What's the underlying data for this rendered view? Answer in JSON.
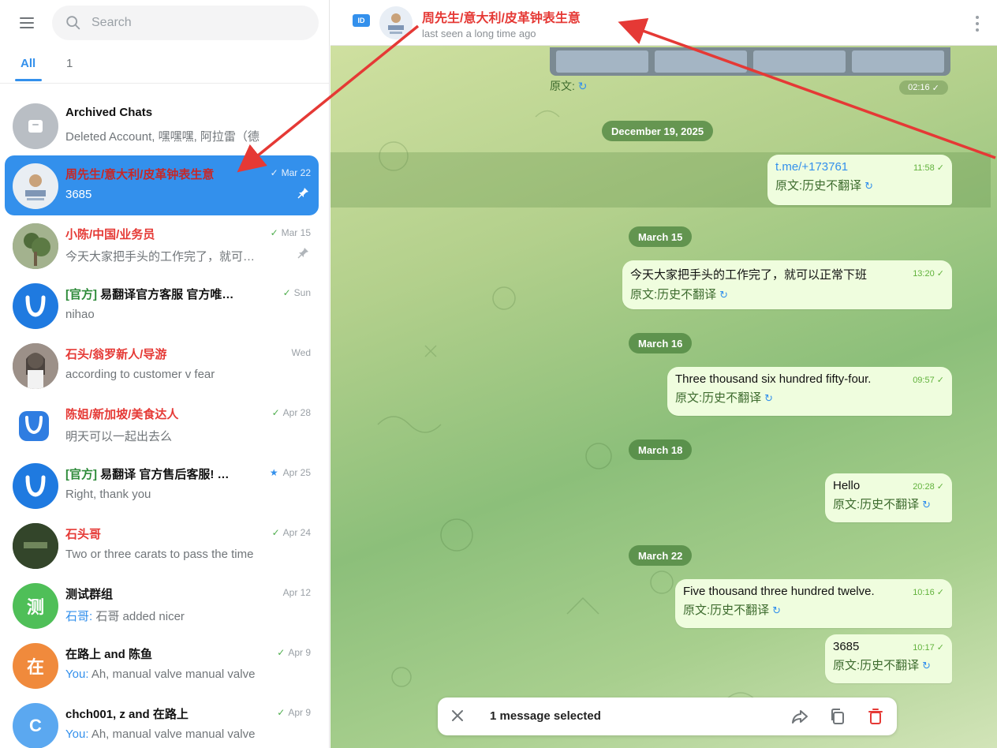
{
  "sidebar": {
    "search_placeholder": "Search",
    "tabs": [
      {
        "label": "All"
      },
      {
        "label": "1"
      }
    ],
    "chats": [
      {
        "name": "Archived Chats",
        "preview": "Deleted Account, 嘿嘿嘿, 阿拉雷（德",
        "time": ""
      },
      {
        "name": "周先生/意大利/皮革钟表生意",
        "preview": "3685",
        "time": "Mar 22"
      },
      {
        "name": "小陈/中国/业务员",
        "preview": "今天大家把手头的工作完了，就可…",
        "time": "Mar 15"
      },
      {
        "name_prefix": "[官方]",
        "name": "易翻译官方客服 官方唯…",
        "preview": "nihao",
        "time": "Sun"
      },
      {
        "name": "石头/翁罗新人/导游",
        "preview": "according to customer v fear",
        "time": "Wed"
      },
      {
        "name": "陈姐/新加坡/美食达人",
        "preview": "明天可以一起出去么",
        "time": "Apr 28"
      },
      {
        "name_prefix": "[官方]",
        "name": "易翻译 官方售后客服! …",
        "preview": "Right, thank you",
        "time": "Apr 25"
      },
      {
        "name": "石头哥",
        "preview": "Two or three carats to pass the time",
        "time": "Apr 24"
      },
      {
        "name": "测试群组",
        "preview": "石哥 added nicer",
        "sender": "石哥:",
        "time": "Apr 12"
      },
      {
        "name": "在路上 and 陈鱼",
        "sender": "You:",
        "preview": "Ah, manual valve manual valve",
        "time": "Apr 9"
      },
      {
        "name": "chch001, z and 在路上",
        "sender": "You:",
        "preview": "Ah, manual valve manual valve",
        "time": "Apr 9"
      }
    ],
    "avatar_letters": {
      "test_group": "测",
      "on_road": "在",
      "chch": "C"
    }
  },
  "header": {
    "badge": "ID",
    "title": "周先生/意大利/皮革钟表生意",
    "subtitle": "last seen a long time ago"
  },
  "messages": {
    "top_meta": "原文:",
    "top_time": "02:16",
    "dates": [
      "December 19, 2025",
      "March 15",
      "March 16",
      "March 18",
      "March 22"
    ],
    "bubbles": [
      {
        "text": "t.me/+173761",
        "translation": "原文:历史不翻译",
        "time": "11:58"
      },
      {
        "text": "今天大家把手头的工作完了，就可以正常下班",
        "translation": "原文:历史不翻译",
        "time": "13:20"
      },
      {
        "text": "Three thousand six hundred fifty-four.",
        "translation": "原文:历史不翻译",
        "time": "09:57"
      },
      {
        "text": "Hello",
        "translation": "原文:历史不翻译",
        "time": "20:28"
      },
      {
        "text": "Five thousand three hundred twelve.",
        "translation": "原文:历史不翻译",
        "time": "10:16"
      },
      {
        "text": "3685",
        "translation": "原文:历史不翻译",
        "time": "10:17"
      }
    ]
  },
  "selection": {
    "text": "1 message selected"
  },
  "colors": {
    "accent": "#3390ec",
    "name_red": "#e53935",
    "bubble_bg": "#effdde",
    "arrow": "#e53935"
  }
}
